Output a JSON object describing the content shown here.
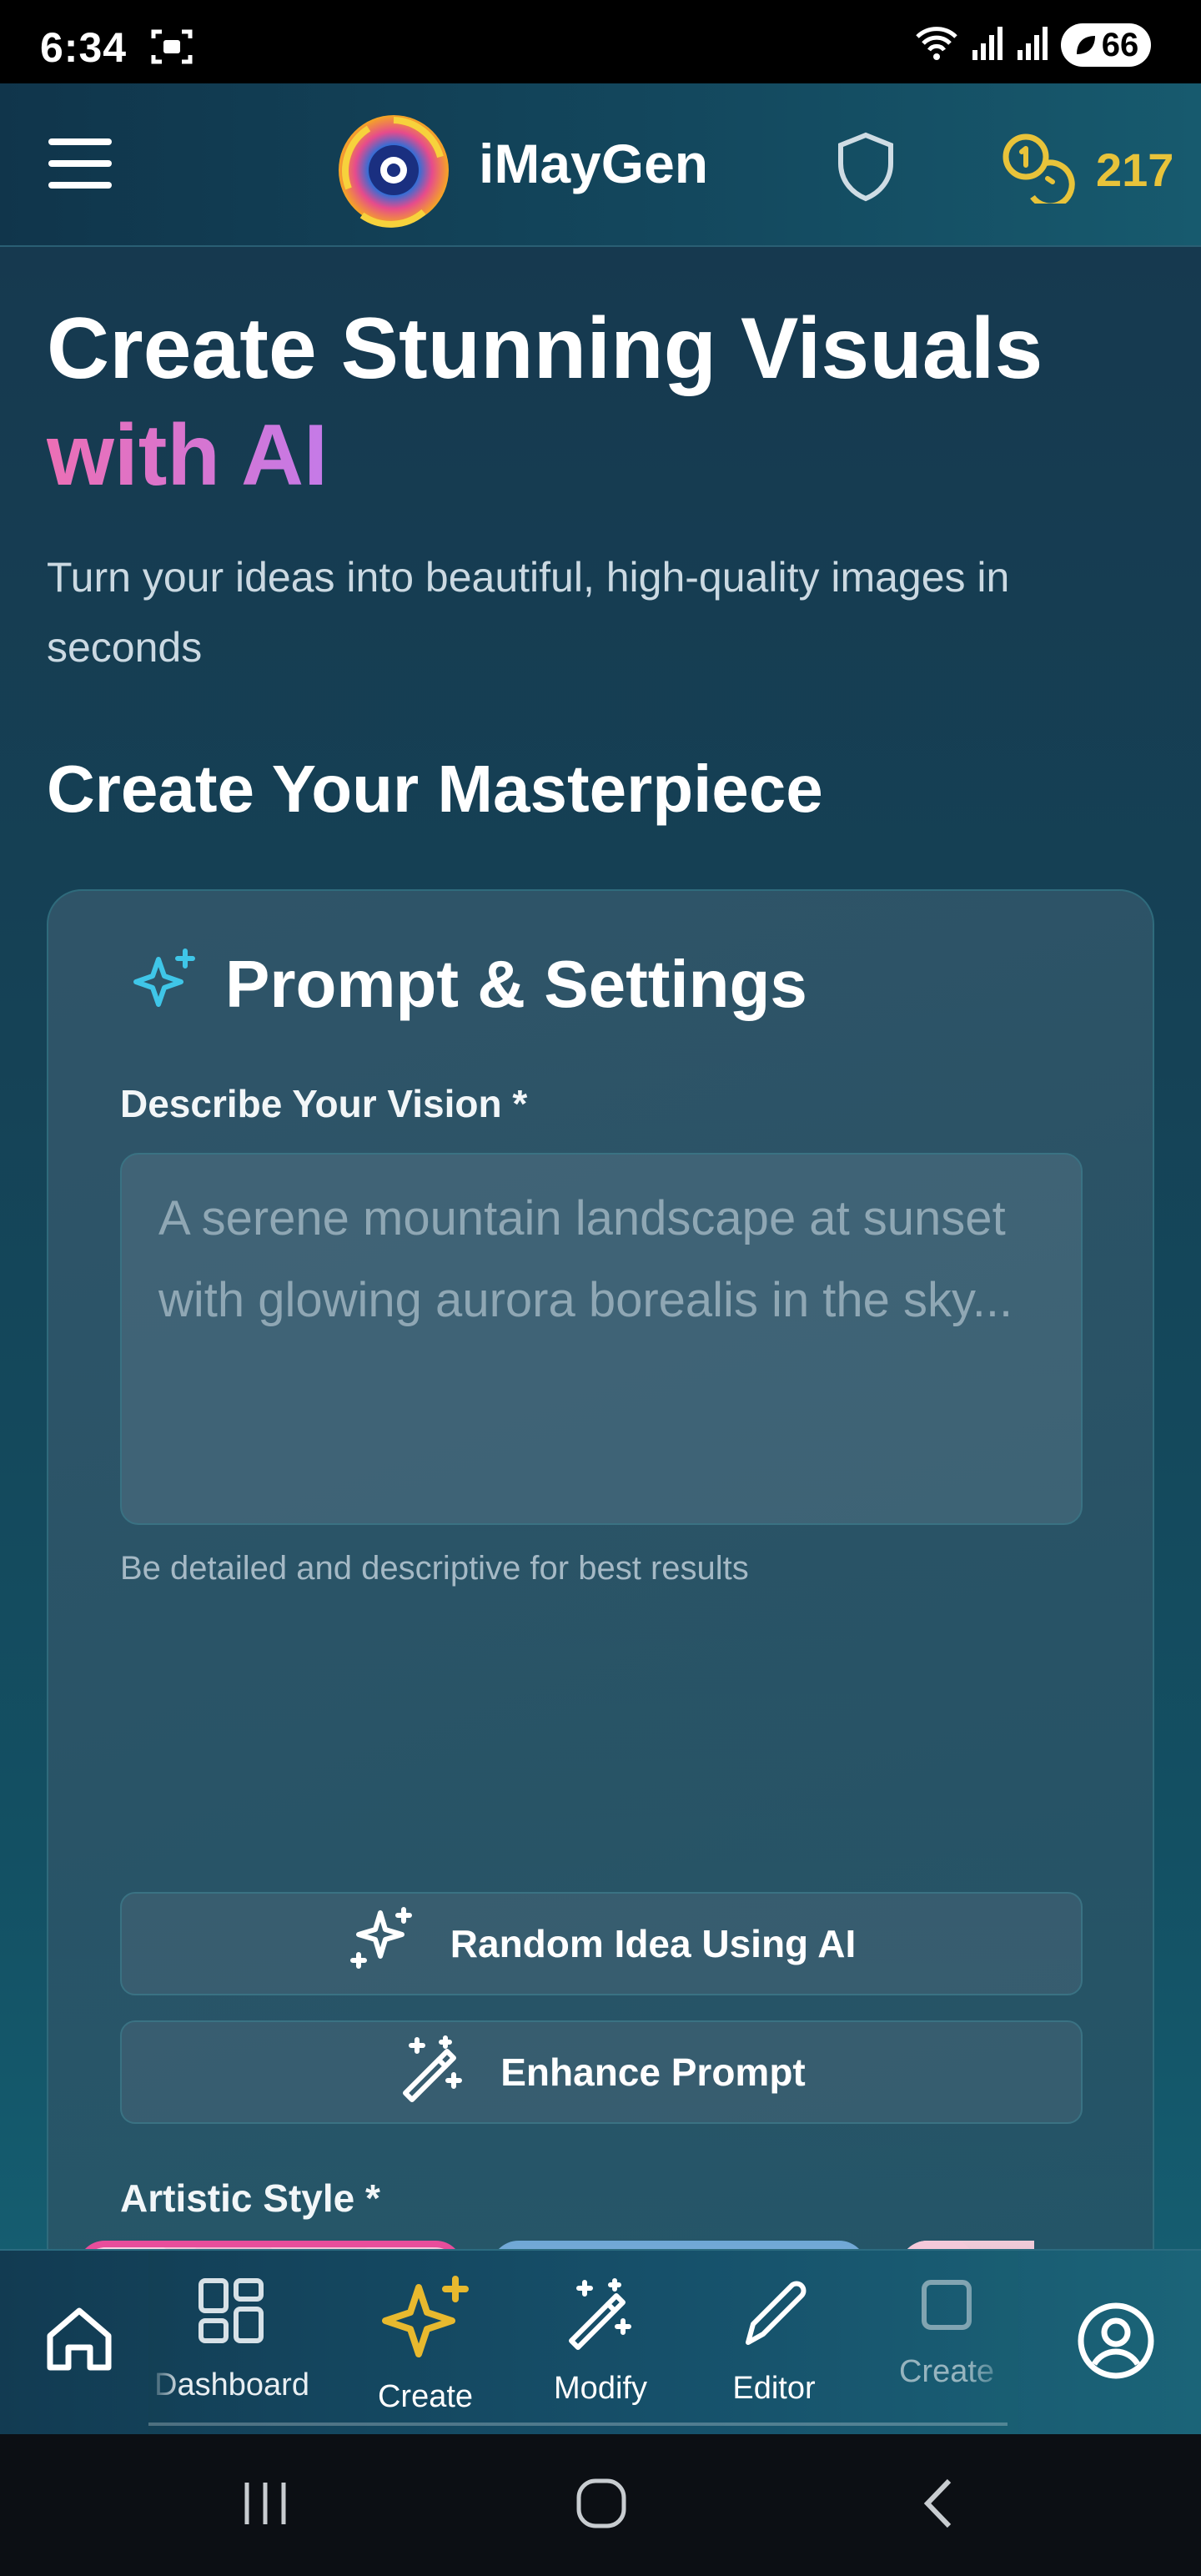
{
  "status_bar": {
    "time": "6:34",
    "battery": "66"
  },
  "header": {
    "brand": "iMayGen",
    "credits": "217"
  },
  "hero": {
    "title_line1": "Create Stunning Visuals",
    "title_line2": "with AI",
    "subtitle": "Turn your ideas into beautiful, high-quality images in seconds"
  },
  "section_title": "Create Your Masterpiece",
  "card": {
    "title": "Prompt & Settings",
    "vision_label": "Describe Your Vision *",
    "prompt_placeholder": "A serene mountain landscape at sunset with glowing aurora borealis in the sky...",
    "prompt_value": "",
    "helper_text": "Be detailed and descriptive for best results",
    "random_idea_label": "Random Idea Using AI",
    "enhance_label": "Enhance Prompt",
    "style_label": "Artistic Style *"
  },
  "bottom_nav": {
    "items": [
      {
        "label": "",
        "icon": "home-icon"
      },
      {
        "label": "Dashboard",
        "icon": "dashboard-icon"
      },
      {
        "label": "Create",
        "icon": "sparkle-icon"
      },
      {
        "label": "Modify",
        "icon": "magic-wand-icon"
      },
      {
        "label": "Editor",
        "icon": "pencil-icon"
      },
      {
        "label": "Create",
        "icon": "square-icon"
      },
      {
        "label": "",
        "icon": "profile-icon"
      }
    ]
  },
  "colors": {
    "accent_pink": "#ec6fb5",
    "accent_purple": "#c47ae8",
    "credit_gold": "#e8c33a",
    "active_nav": "#e8b92e",
    "sparkle_cyan": "#3fc6e8"
  }
}
